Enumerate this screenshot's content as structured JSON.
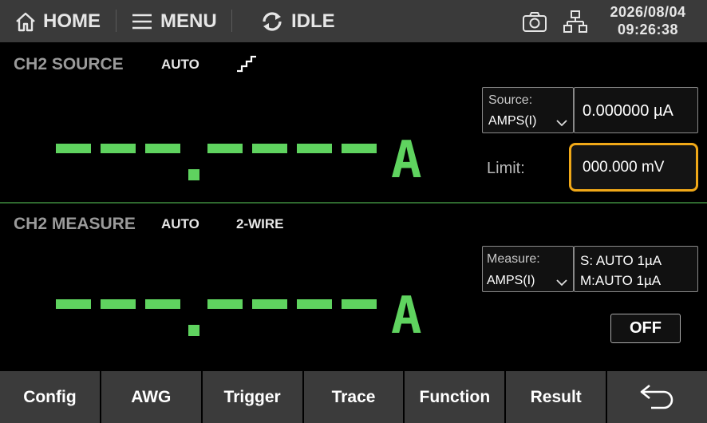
{
  "topbar": {
    "home_label": "HOME",
    "menu_label": "MENU",
    "status_label": "IDLE",
    "date": "2026/08/04",
    "time": "09:26:38"
  },
  "source": {
    "title": "CH2 SOURCE",
    "range_mode": "AUTO",
    "unit": "A",
    "source_label": "Source:",
    "source_value": "AMPS(I)",
    "level_value": "0.000000 µA",
    "limit_label": "Limit:",
    "limit_value": "000.000 mV"
  },
  "measure": {
    "title": "CH2 MEASURE",
    "range_mode": "AUTO",
    "wire_mode": "2-WIRE",
    "unit": "A",
    "measure_label": "Measure:",
    "measure_value": "AMPS(I)",
    "source_range": "S:  AUTO 1µA",
    "measure_range": "M:AUTO 1µA",
    "output_label": "OFF"
  },
  "bottombar": {
    "items": [
      "Config",
      "AWG",
      "Trigger",
      "Trace",
      "Function",
      "Result"
    ]
  },
  "colors": {
    "accent_green": "#5fd35f",
    "highlight_orange": "#f0a818"
  }
}
